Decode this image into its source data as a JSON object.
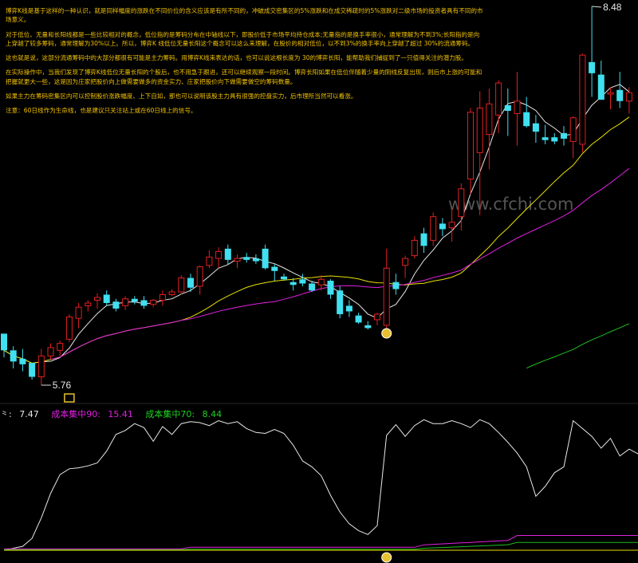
{
  "notes": [
    "博弈K线是基于这样的一种认识，就是同样幅度的涨跌在不同价位的含义应该是有所不同的，冲破成交密集区的5%涨跌和在成交稀疏时的5%涨跌对二级市场的投资者具有不同的市场意义。",
    "对于低位、无量和长阳线都是一些比较相对的概念，低位指的是筹码分布在中轴线以下，即股价低于市场平均持仓成本;无量指的是换手率很小，通常理解为不到3%;长阳指的是向上穿越了较多筹码，通常理解为30%以上。所以，博弈K 线低位无量长阳这个概念可以这么来理解，在股价的相对低位，以不到3%的换手率向上穿越了超过 30%的流通筹码。",
    "这也就是说，这部分流通筹码中的大部分都很有可能是主力筹码。用博弈K线来表达的话，也可以说这根长度为 30的博弈长阳，能帮助我们捕捉到了一只值得关注的潜力股。",
    "在实际操作中，当我们发现了博弈K线低位无量长阳的个股后，也不用急于跟进，还可以继续观察一段时间。博弈长阳如果在低位伴随着少量的阴线反复出现，则后市上涨的可能和把握就更大一些，这是因为庄家把股价向上做需要做多的资金实力、庄家把股价向下做需要做空的筹码数量。",
    "如果主力在筹码密集区内可以控制股价涨跌幅度、上下自如，那也可以说明该股主力具有很强的控盘实力，后市理所当然可以看涨。",
    "注意：60日线作为生命线，也是建议只关注站上或在60日线上的信号。"
  ],
  "watermark": "www.cfchi.com",
  "indicator": [
    {
      "label": "⺀:",
      "value": "7.47",
      "color": "#e8e8e8"
    },
    {
      "label": "成本集中90:",
      "value": "15.41",
      "color": "#e020e0"
    },
    {
      "label": "成本集中70:",
      "value": "8.44",
      "color": "#20d020"
    }
  ],
  "chart_data": {
    "type": "candlestick",
    "price_high_label": "8.48",
    "price_low_label": "5.76",
    "colors": {
      "up": "#e02020",
      "down": "#40e0f0",
      "ma_white": "#e8e8e8",
      "ma_yellow": "#e8e000",
      "ma_magenta": "#e020e0",
      "ma_green": "#20c020"
    },
    "ohlc": [
      [
        6.13,
        6.13,
        5.96,
        6.01
      ],
      [
        6.01,
        6.04,
        5.88,
        5.93
      ],
      [
        5.95,
        6.02,
        5.86,
        5.91
      ],
      [
        5.92,
        5.92,
        5.8,
        5.82
      ],
      [
        5.82,
        6.02,
        5.76,
        5.97
      ],
      [
        5.97,
        6.06,
        5.95,
        6.03
      ],
      [
        6.01,
        6.08,
        5.97,
        6.06
      ],
      [
        6.09,
        6.27,
        6.07,
        6.25
      ],
      [
        6.24,
        6.35,
        6.17,
        6.32
      ],
      [
        6.33,
        6.37,
        6.29,
        6.35
      ],
      [
        6.37,
        6.42,
        6.31,
        6.39
      ],
      [
        6.41,
        6.44,
        6.33,
        6.35
      ],
      [
        6.36,
        6.38,
        6.29,
        6.31
      ],
      [
        6.33,
        6.4,
        6.3,
        6.38
      ],
      [
        6.38,
        6.4,
        6.34,
        6.36
      ],
      [
        6.37,
        6.4,
        6.31,
        6.33
      ],
      [
        6.34,
        6.38,
        6.32,
        6.37
      ],
      [
        6.37,
        6.44,
        6.33,
        6.41
      ],
      [
        6.41,
        6.45,
        6.4,
        6.43
      ],
      [
        6.43,
        6.55,
        6.41,
        6.53
      ],
      [
        6.53,
        6.56,
        6.43,
        6.46
      ],
      [
        6.47,
        6.62,
        6.41,
        6.61
      ],
      [
        6.62,
        6.73,
        6.6,
        6.68
      ],
      [
        6.67,
        6.75,
        6.6,
        6.72
      ],
      [
        6.74,
        6.77,
        6.63,
        6.66
      ],
      [
        6.65,
        6.7,
        6.6,
        6.67
      ],
      [
        6.68,
        6.71,
        6.64,
        6.66
      ],
      [
        6.67,
        6.7,
        6.63,
        6.65
      ],
      [
        6.74,
        6.77,
        6.59,
        6.6
      ],
      [
        6.61,
        6.63,
        6.51,
        6.58
      ],
      [
        6.54,
        6.56,
        6.51,
        6.52
      ],
      [
        6.5,
        6.53,
        6.44,
        6.48
      ],
      [
        6.52,
        6.56,
        6.47,
        6.49
      ],
      [
        6.49,
        6.51,
        6.43,
        6.44
      ],
      [
        6.48,
        6.55,
        6.44,
        6.52
      ],
      [
        6.51,
        6.52,
        6.38,
        6.41
      ],
      [
        6.44,
        6.47,
        6.24,
        6.27
      ],
      [
        6.33,
        6.37,
        6.25,
        6.29
      ],
      [
        6.26,
        6.28,
        6.2,
        6.21
      ],
      [
        6.19,
        6.22,
        6.16,
        6.17
      ],
      [
        6.23,
        6.28,
        6.19,
        6.27
      ],
      [
        6.19,
        6.74,
        6.13,
        6.6
      ],
      [
        6.5,
        6.56,
        6.41,
        6.45
      ],
      [
        6.62,
        6.69,
        6.53,
        6.67
      ],
      [
        6.69,
        6.83,
        6.67,
        6.8
      ],
      [
        6.85,
        6.89,
        6.71,
        6.76
      ],
      [
        6.8,
        7.0,
        6.76,
        6.97
      ],
      [
        6.92,
        6.96,
        6.83,
        6.88
      ],
      [
        6.89,
        7.03,
        6.79,
        6.93
      ],
      [
        6.97,
        7.21,
        6.87,
        7.17
      ],
      [
        7.24,
        7.75,
        7.13,
        7.72
      ],
      [
        7.43,
        7.87,
        6.98,
        7.75
      ],
      [
        7.56,
        7.89,
        7.31,
        7.78
      ],
      [
        7.7,
        7.95,
        7.57,
        7.93
      ],
      [
        7.77,
        7.89,
        7.55,
        7.73
      ],
      [
        7.71,
        8.01,
        7.48,
        7.8
      ],
      [
        7.72,
        7.83,
        7.61,
        7.62
      ],
      [
        7.64,
        7.7,
        7.5,
        7.58
      ],
      [
        7.54,
        7.63,
        7.49,
        7.52
      ],
      [
        7.54,
        7.57,
        7.49,
        7.51
      ],
      [
        7.57,
        7.62,
        7.48,
        7.53
      ],
      [
        7.51,
        7.69,
        7.39,
        7.68
      ],
      [
        7.49,
        8.14,
        7.43,
        8.13
      ],
      [
        8.08,
        8.48,
        7.83,
        8.0
      ],
      [
        7.99,
        8.09,
        7.82,
        7.81
      ],
      [
        7.85,
        7.9,
        7.74,
        7.86
      ],
      [
        7.88,
        8.01,
        7.75,
        7.8
      ],
      [
        7.8,
        7.9,
        7.71,
        7.86
      ]
    ]
  }
}
